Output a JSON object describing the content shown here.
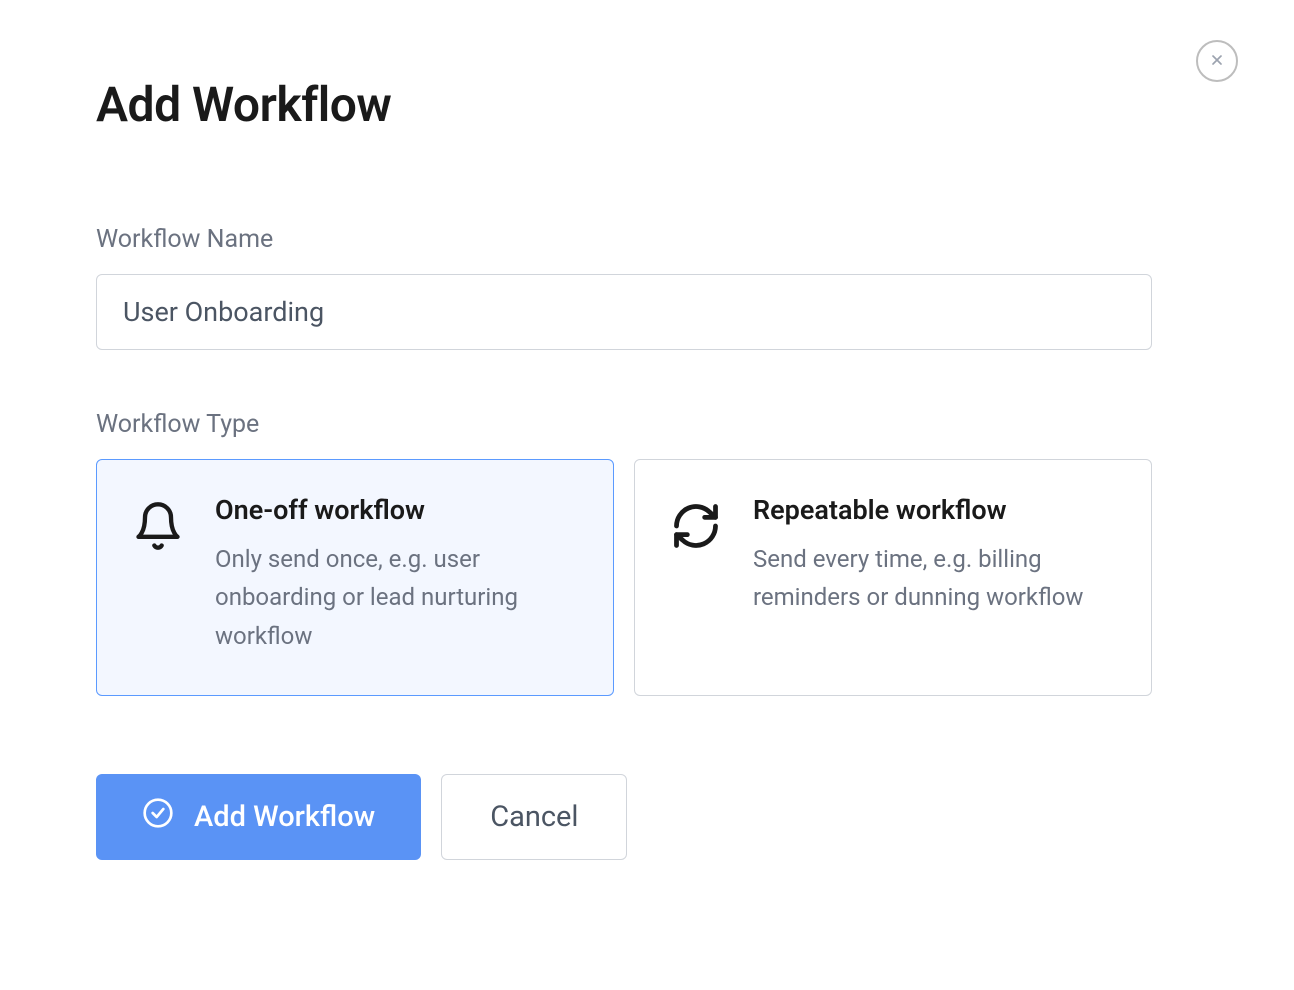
{
  "dialog": {
    "title": "Add Workflow",
    "workflowNameLabel": "Workflow Name",
    "workflowNameValue": "User Onboarding",
    "workflowTypeLabel": "Workflow Type",
    "types": [
      {
        "title": "One-off workflow",
        "description": "Only send once, e.g. user onboarding or lead nurturing workflow",
        "icon": "bell-icon",
        "selected": true
      },
      {
        "title": "Repeatable workflow",
        "description": "Send every time, e.g. billing reminders or dunning workflow",
        "icon": "refresh-icon",
        "selected": false
      }
    ],
    "submitLabel": "Add Workflow",
    "cancelLabel": "Cancel"
  }
}
